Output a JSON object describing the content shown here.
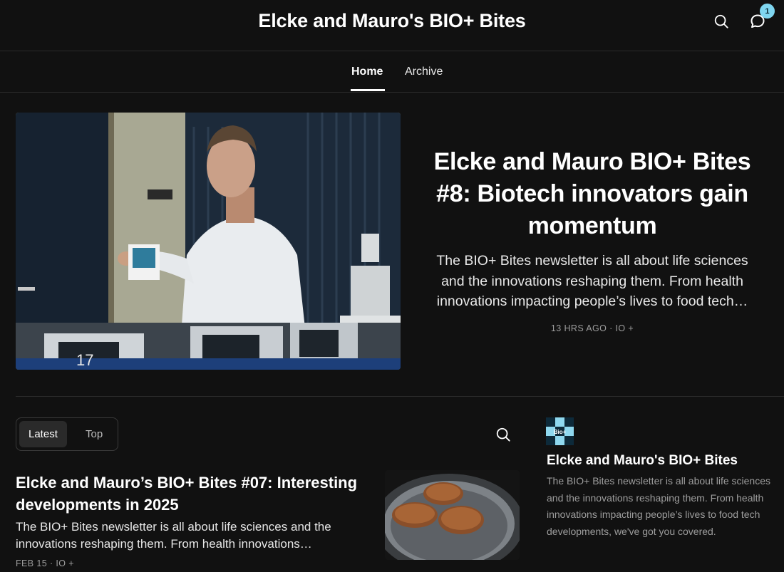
{
  "header": {
    "title": "Elcke and Mauro's BIO+ Bites",
    "search_icon": "search-icon",
    "chat_icon": "chat-bubble-icon",
    "notification_count": "1"
  },
  "nav": {
    "tabs": [
      {
        "label": "Home",
        "active": true
      },
      {
        "label": "Archive",
        "active": false
      }
    ]
  },
  "hero": {
    "title": "Elcke and Mauro BIO+ Bites #8: Biotech innovators gain momentum",
    "description": "The BIO+ Bites newsletter is all about life sciences and the innovations reshaping them. From health innovations impacting people’s lives to food tech…",
    "meta": "13 HRS AGO · IO +"
  },
  "feed": {
    "tabs": [
      {
        "label": "Latest",
        "active": true
      },
      {
        "label": "Top",
        "active": false
      }
    ],
    "search_icon": "search-icon",
    "posts": [
      {
        "title": "Elcke and Mauro’s BIO+ Bites #07: Interesting developments in 2025",
        "description": "The BIO+ Bites newsletter is all about life sciences and the innovations reshaping them. From health innovations…",
        "meta": "FEB 15 · IO +"
      }
    ]
  },
  "sidebar": {
    "logo_text": "Bio+",
    "name": "Elcke and Mauro's BIO+ Bites",
    "description": "The BIO+ Bites newsletter is all about life sciences and the innovations reshaping them. From health innovations impacting people’s lives to food tech developments, we've got you covered."
  },
  "colors": {
    "background": "#111111",
    "accent_badge": "#7fd6f0",
    "muted_text": "#9d9d9d",
    "divider": "#2b2b2b"
  }
}
